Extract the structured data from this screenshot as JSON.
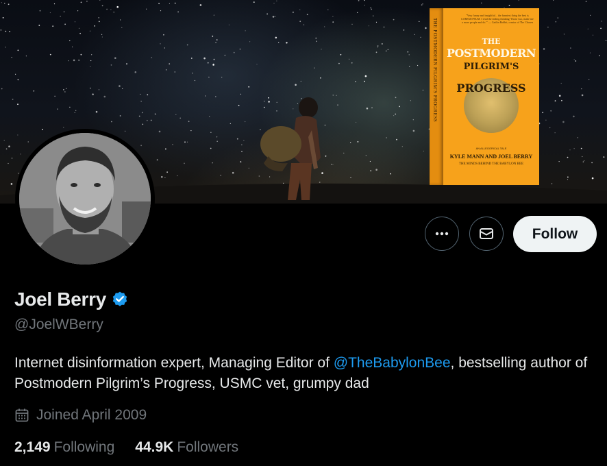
{
  "book": {
    "quote": "\"Very funny and insightful... the funniest thing the best is LOREM IPSUM. I read the ending thinking 'Those two, make me a more people and do.'\" — Caitlin Bobbit, creator of The Chosen",
    "spine": "THE POSTMODERN PILGRIM'S PROGRESS",
    "title_line1": "THE",
    "title_line2": "POSTMODERN",
    "title_line3": "PILGRIM'S",
    "title_line4": "PROGRESS",
    "subtitle": "AN ALLEGORICAL TALE",
    "authors": "KYLE MANN AND JOEL BERRY",
    "minds": "THE MINDS BEHIND THE BABYLON BEE"
  },
  "actions": {
    "more_icon": "more-horizontal-icon",
    "message_icon": "envelope-icon",
    "follow_label": "Follow"
  },
  "profile": {
    "display_name": "Joel Berry",
    "verified_icon": "verified-badge-icon",
    "handle": "@JoelWBerry",
    "bio_before": "Internet disinformation expert, Managing Editor of ",
    "bio_mention": "@TheBabylonBee",
    "bio_after": ", bestselling author of Postmodern Pilgrim’s Progress, USMC vet, grumpy dad",
    "joined_icon": "calendar-icon",
    "joined": "Joined April 2009",
    "following_count": "2,149",
    "following_label": "Following",
    "followers_count": "44.9K",
    "followers_label": "Followers"
  },
  "colors": {
    "background": "#000000",
    "accent": "#1d9bf0",
    "muted": "#71767b",
    "text": "#e7e9ea",
    "follow_bg": "#eff3f4",
    "book": "#f7a21b"
  }
}
